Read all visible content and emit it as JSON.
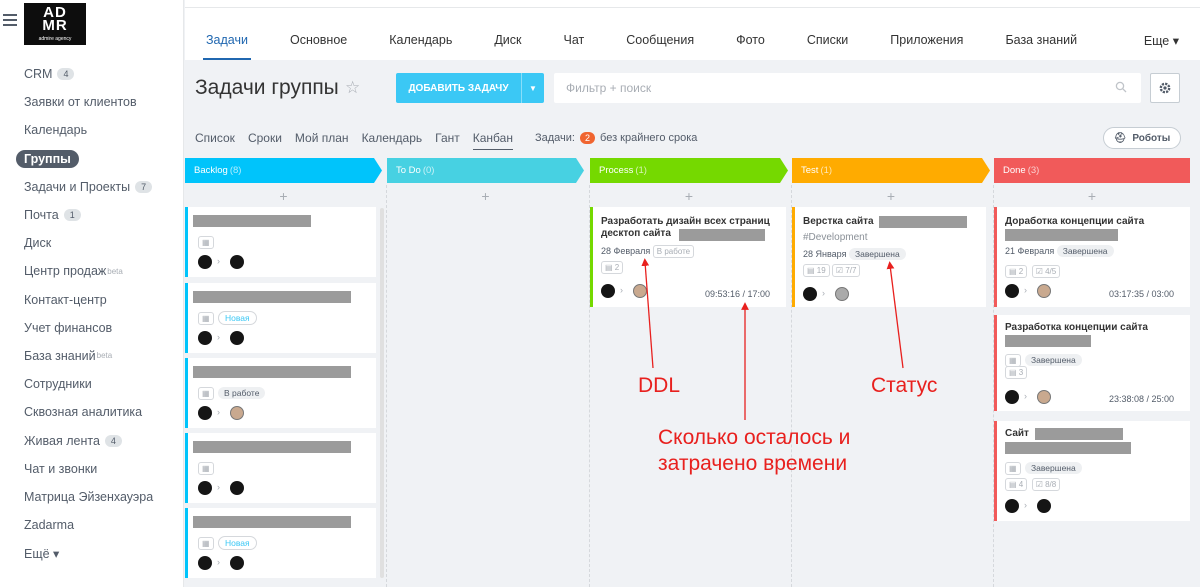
{
  "logo": {
    "line1": "AD",
    "line2": "MR",
    "sub": "admire agency"
  },
  "sidebar": {
    "items": [
      {
        "label": "CRM",
        "badge": "4"
      },
      {
        "label": "Заявки от клиентов"
      },
      {
        "label": "Календарь"
      },
      {
        "label": "Группы",
        "active": true
      },
      {
        "label": "Задачи и Проекты",
        "badge": "7"
      },
      {
        "label": "Почта",
        "badge": "1"
      },
      {
        "label": "Диск"
      },
      {
        "label": "Центр продаж",
        "sup": "beta"
      },
      {
        "label": "Контакт-центр"
      },
      {
        "label": "Учет финансов"
      },
      {
        "label": "База знаний",
        "sup": "beta"
      },
      {
        "label": "Сотрудники"
      },
      {
        "label": "Сквозная аналитика"
      },
      {
        "label": "Живая лента",
        "badge": "4"
      },
      {
        "label": "Чат и звонки"
      },
      {
        "label": "Матрица Эйзенхауэра"
      },
      {
        "label": "Zadarma"
      },
      {
        "label": "Ещё ▾"
      }
    ]
  },
  "tabs": [
    "Задачи",
    "Основное",
    "Календарь",
    "Диск",
    "Чат",
    "Сообщения",
    "Фото",
    "Списки",
    "Приложения",
    "База знаний",
    "Еще ▾"
  ],
  "header": {
    "title": "Задачи группы",
    "add_button": "ДОБАВИТЬ ЗАДАЧУ",
    "search_placeholder": "Фильтр + поиск"
  },
  "views": [
    "Список",
    "Сроки",
    "Мой план",
    "Календарь",
    "Гант",
    "Канбан"
  ],
  "task_counter": {
    "label": "Задачи:",
    "count": "2",
    "suffix": "без крайнего срока"
  },
  "robots_label": "Роботы",
  "columns": [
    {
      "name": "Backlog",
      "count": "(8)",
      "color": "#00c4fb"
    },
    {
      "name": "To Do",
      "count": "(0)",
      "color": "#47d1e2"
    },
    {
      "name": "Process",
      "count": "(1)",
      "color": "#75d900"
    },
    {
      "name": "Test",
      "count": "(1)",
      "color": "#ffab00"
    },
    {
      "name": "Done",
      "count": "(3)",
      "color": "#f15a5a"
    }
  ],
  "cards": {
    "process": {
      "title": "Разработать дизайн всех страниц десктоп сайта",
      "date": "28 Февраля",
      "status": "В работе",
      "checklist": "2",
      "time": "09:53:16 / 17:00"
    },
    "test": {
      "title": "Верстка сайта",
      "tag": "#Development",
      "date": "28 Января",
      "status": "Завершена",
      "comments": "19",
      "checklist": "7/7"
    },
    "done": [
      {
        "title": "Доработка концепции сайта",
        "date": "21 Февраля",
        "status": "Завершена",
        "comments": "2",
        "checklist": "4/5",
        "time": "03:17:35 / 03:00"
      },
      {
        "title": "Разработка концепции сайта",
        "status": "Завершена",
        "comments": "3",
        "time": "23:38:08 / 25:00"
      },
      {
        "title": "Сайт",
        "status": "Завершена",
        "comments": "4",
        "checklist": "8/8"
      }
    ],
    "backlog_tags": [
      "Новая",
      "В работе",
      "Новая"
    ]
  },
  "annotations": {
    "ddl": "DDL",
    "status": "Статус",
    "time": "Сколько осталось и затрачено времени"
  }
}
